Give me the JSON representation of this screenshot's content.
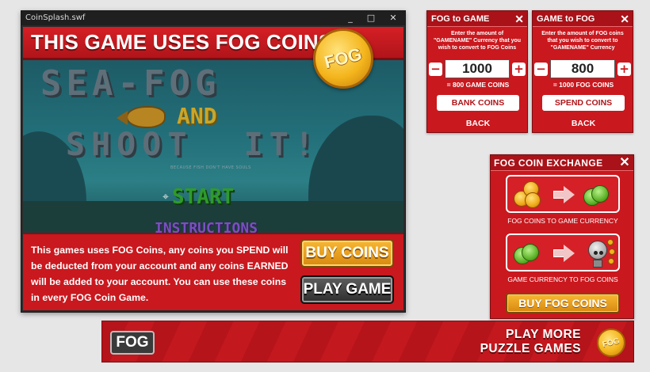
{
  "window": {
    "title": "CoinSplash.swf",
    "controls": {
      "minimize": "_",
      "maximize": "□",
      "close": "✕"
    }
  },
  "splash": {
    "banner": "THIS GAME USES FOG COINS!",
    "coin_label": "FOG",
    "message": "This games uses FOG Coins, any coins you SPEND will be deducted from your account and any coins EARNED will be added to your account. You can use these coins in every FOG Coin Game.",
    "buy_button": "BUY COINS",
    "play_button": "PLAY GAME"
  },
  "game_screen": {
    "title_line1": "SEA-FOG",
    "title_and": "AND",
    "title_line2": "SHOOT  IT!",
    "tagline": "BECAUSE FISH DON'T HAVE SOULS",
    "menu_start": "START",
    "menu_instructions": "INSTRUCTIONS",
    "cursor_glyph": "⌖"
  },
  "fog_to_game": {
    "title": "FOG to GAME",
    "close": "✕",
    "description": "Enter the amount of \"GAMENAME\" Currency that you wish to convert to FOG Coins",
    "minus": "−",
    "plus": "+",
    "value": "1000",
    "result": "= 800 GAME COINS",
    "action": "BANK COINS",
    "back": "BACK"
  },
  "game_to_fog": {
    "title": "GAME to FOG",
    "close": "✕",
    "description": "Enter the amount of FOG coins that you wish to convert to \"GAMENAME\" Currency",
    "minus": "−",
    "plus": "+",
    "value": "800",
    "result": "= 1000 FOG COINS",
    "action": "SPEND COINS",
    "back": "BACK"
  },
  "exchange": {
    "title": "FOG COIN EXCHANGE",
    "close": "✕",
    "option1_label": "FOG COINS TO GAME CURRENCY",
    "option2_label": "GAME CURRENCY TO FOG COINS",
    "buy_button": "BUY FOG COINS"
  },
  "promo_bar": {
    "logo": "FOG",
    "line1": "PLAY MORE",
    "line2": "PUZZLE GAMES",
    "coin_label": "FOG"
  },
  "colors": {
    "brand_red": "#c9181e",
    "gold": "#f4b51c",
    "dark_button": "#3a3a3a"
  }
}
